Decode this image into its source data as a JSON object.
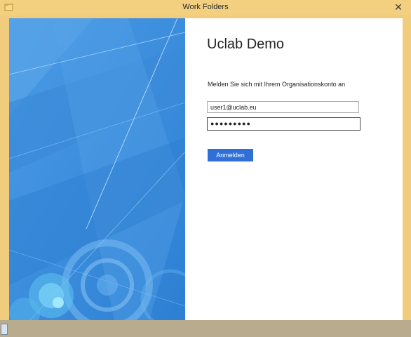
{
  "window": {
    "title": "Work Folders",
    "close_glyph": "✕"
  },
  "signin": {
    "org_title": "Uclab Demo",
    "prompt": "Melden Sie sich mit Ihrem Organisationskonto an",
    "email_value": "user1@uclab.eu",
    "password_mask": "●●●●●●●●●",
    "button_label": "Anmelden"
  },
  "colors": {
    "hero_blue": "#3f8fdc",
    "button_blue": "#2f6fd8",
    "window_frame": "#f3cf80"
  },
  "icons": {
    "app": "work-folders-icon",
    "close": "close-icon"
  }
}
